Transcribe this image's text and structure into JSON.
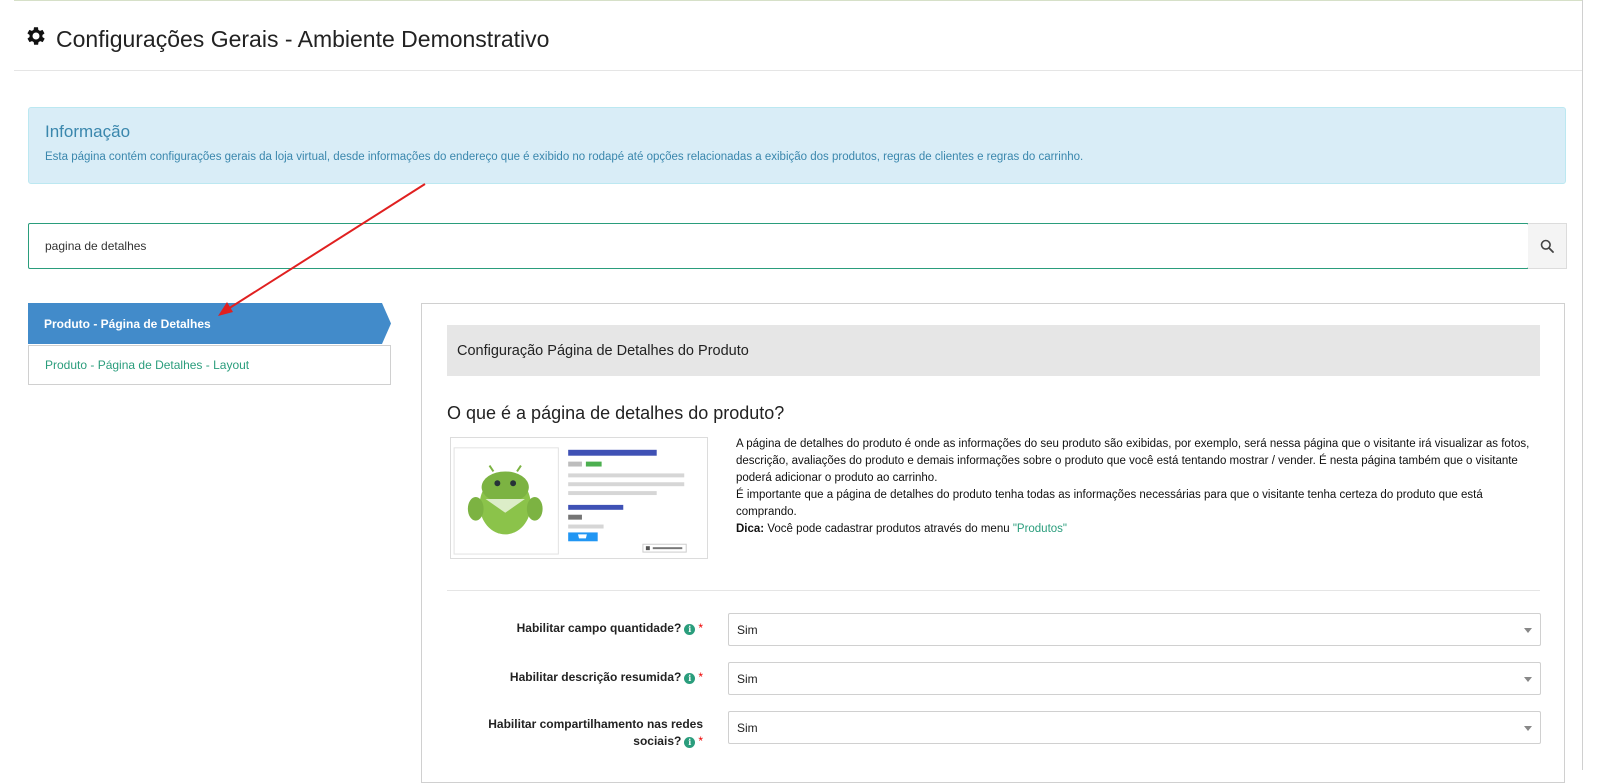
{
  "header": {
    "title": "Configurações Gerais - Ambiente Demonstrativo"
  },
  "info": {
    "title": "Informação",
    "text": "Esta página contém configurações gerais da loja virtual, desde informações do endereço que é exibido no rodapé até opções relacionadas a exibição dos produtos, regras de clientes e regras do carrinho."
  },
  "search": {
    "value": "pagina de detalhes"
  },
  "nav": {
    "items": [
      {
        "label": "Produto - Página de Detalhes",
        "active": true
      },
      {
        "label": "Produto - Página de Detalhes - Layout",
        "active": false
      }
    ]
  },
  "section": {
    "header": "Configuração Página de Detalhes do Produto",
    "question": "O que é a página de detalhes do produto?",
    "p1": "A página de detalhes do produto é onde as informações do seu produto são exibidas, por exemplo, será nessa página que o visitante irá visualizar as fotos, descrição, avaliações do produto e demais informações sobre o produto que você está tentando mostrar / vender. É nesta página também que o visitante poderá adicionar o produto ao carrinho.",
    "p2": "É importante que a página de detalhes do produto tenha todas as informações necessárias para que o visitante tenha certeza do produto que está comprando.",
    "tip_label": "Dica:",
    "tip_text": " Você pode cadastrar produtos através do menu ",
    "tip_link": "\"Produtos\""
  },
  "form": {
    "fields": [
      {
        "label": "Habilitar campo quantidade?",
        "value": "Sim"
      },
      {
        "label": "Habilitar descrição resumida?",
        "value": "Sim"
      },
      {
        "label_line1": "Habilitar compartilhamento nas redes",
        "label_line2": "sociais?",
        "value": "Sim"
      }
    ],
    "required_mark": "*",
    "info_glyph": "i"
  },
  "colors": {
    "accent": "#2a9d7c",
    "nav_active": "#428bca",
    "info_bg": "#d9edf7",
    "info_text": "#3a87ad",
    "arrow": "#e02020"
  }
}
